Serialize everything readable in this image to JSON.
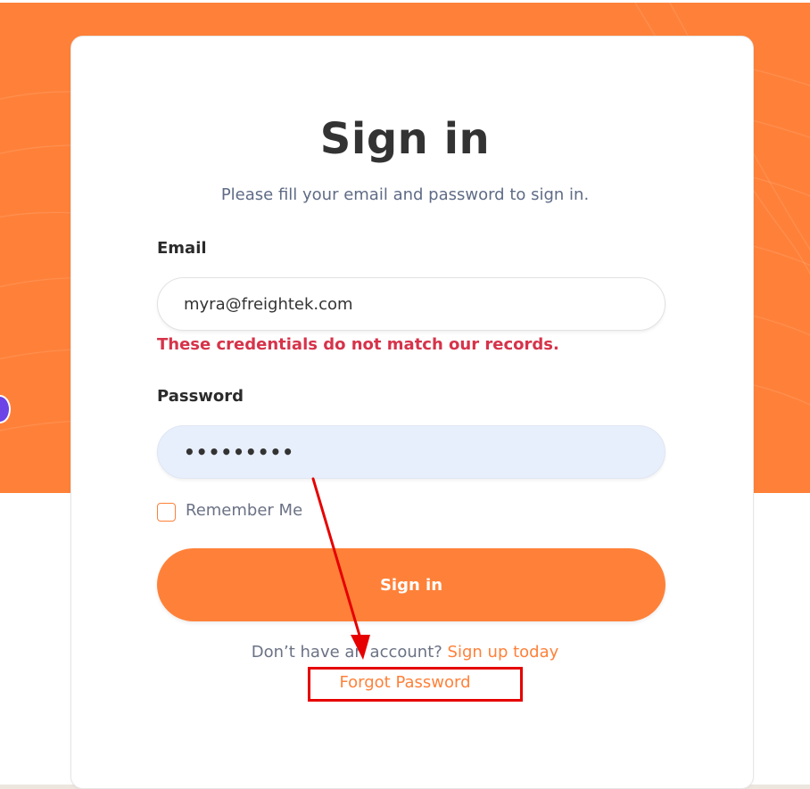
{
  "auth": {
    "title": "Sign in",
    "subtitle": "Please fill your email and password to sign in.",
    "email": {
      "label": "Email",
      "value": "myra@freightek.com"
    },
    "error": "These credentials do not match our records.",
    "password": {
      "label": "Password",
      "masked_value": "•••••••••"
    },
    "remember_me": {
      "label": "Remember Me",
      "checked": false
    },
    "submit_label": "Sign in",
    "signup": {
      "prompt": "Don’t have an account?",
      "link": "Sign up today"
    },
    "forgot_password": "Forgot Password"
  },
  "colors": {
    "accent": "#ff8139",
    "error": "#d6334a",
    "annotation": "#e60000",
    "password_fill": "#e8effc"
  }
}
